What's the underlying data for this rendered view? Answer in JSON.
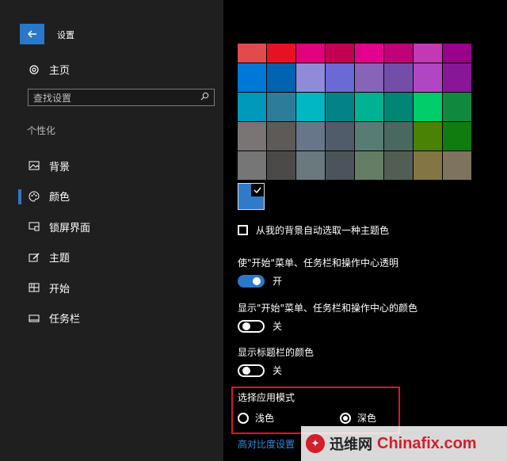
{
  "window": {
    "title": "设置"
  },
  "sidebar": {
    "home_label": "主页",
    "search_placeholder": "查找设置",
    "section_label": "个性化",
    "items": [
      {
        "label": "背景",
        "icon": "picture-icon",
        "active": false
      },
      {
        "label": "颜色",
        "icon": "palette-icon",
        "active": true
      },
      {
        "label": "锁屏界面",
        "icon": "lock-screen-icon",
        "active": false
      },
      {
        "label": "主题",
        "icon": "theme-brush-icon",
        "active": false
      },
      {
        "label": "开始",
        "icon": "start-grid-icon",
        "active": false
      },
      {
        "label": "任务栏",
        "icon": "taskbar-icon",
        "active": false
      }
    ]
  },
  "colors": {
    "swatches": [
      [
        "#e24a4e",
        "#e81123",
        "#e3007c",
        "#c30052",
        "#e3008c",
        "#bf0077",
        "#c239b3",
        "#9a0089"
      ],
      [
        "#0078d7",
        "#0063b1",
        "#8e8cd8",
        "#6b69d6",
        "#8764b8",
        "#744da9",
        "#b146c2",
        "#881798"
      ],
      [
        "#0099bc",
        "#2d7d9a",
        "#00b7c3",
        "#038387",
        "#00b294",
        "#018574",
        "#00cc6a",
        "#10893e"
      ],
      [
        "#7a7574",
        "#5d5a58",
        "#68768a",
        "#515c6b",
        "#567c73",
        "#486860",
        "#498205",
        "#107c10"
      ],
      [
        "#767676",
        "#4c4a48",
        "#69797e",
        "#4a5459",
        "#647c64",
        "#525e54",
        "#847545",
        "#7e735f"
      ]
    ],
    "custom_color": "#2f7bc9",
    "auto_pick_label": "从我的背景自动选取一种主题色",
    "transparency": {
      "label": "使\"开始\"菜单、任务栏和操作中心透明",
      "state": "开",
      "on": true
    },
    "show_start_color": {
      "label": "显示\"开始\"菜单、任务栏和操作中心的颜色",
      "state": "关",
      "on": false
    },
    "show_title_color": {
      "label": "显示标题栏的颜色",
      "state": "关",
      "on": false
    },
    "app_mode": {
      "label": "选择应用模式",
      "light": "浅色",
      "dark": "深色",
      "selected": "dark"
    },
    "contrast_link": "高对比度设置"
  },
  "watermark": {
    "cn": "迅维网",
    "en": "Chinafix.com"
  }
}
